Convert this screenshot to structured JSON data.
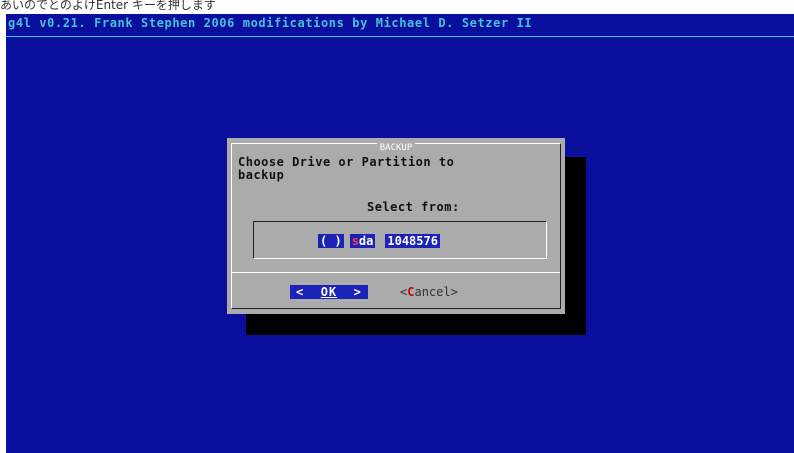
{
  "top_strip": {
    "text": "あいのでとのよけEnter キーを押します"
  },
  "screen": {
    "title": "g4l v0.21. Frank Stephen 2006 modifications by Michael D. Setzer II"
  },
  "dialog": {
    "title": "BACKUP",
    "prompt": "Choose Drive or Partition to\nbackup",
    "select_label": "Select from:",
    "options": [
      {
        "radio": "( )",
        "drive_hot": "s",
        "drive_rest": "da",
        "size": "1048576"
      }
    ],
    "buttons": {
      "ok_left": "<",
      "ok_label": "OK",
      "ok_right": ">",
      "cancel_open": "<",
      "cancel_hot": "C",
      "cancel_rest": "ancel",
      "cancel_close": ">"
    }
  },
  "colors": {
    "screen_bg": "#0a0f9e",
    "title_fg": "#45c1d9",
    "dialog_bg": "#ababab",
    "highlight_bg": "#1a22b8",
    "hotkey": "#d40000"
  }
}
